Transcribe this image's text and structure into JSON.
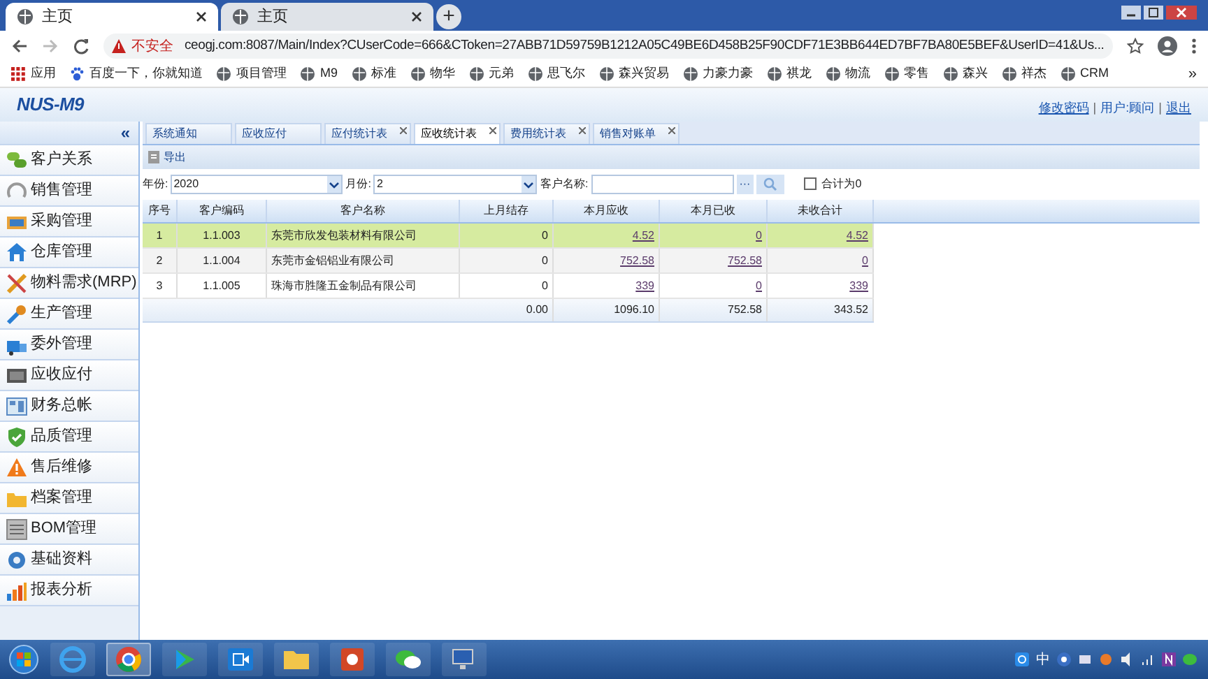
{
  "browser": {
    "tabs": [
      {
        "title": "主页",
        "selected": true
      },
      {
        "title": "主页",
        "selected": false
      }
    ],
    "new_tab": "+",
    "security": "不安全",
    "url": "ceogj.com:8087/Main/Index?CUserCode=666&CToken=27ABB71D59759B1212A05C49BE6D458B25F90CDF71E3BB644ED7BF7BA80E5BEF&UserID=41&Us...",
    "bookmarks": [
      "应用",
      "百度一下，你就知道",
      "项目管理",
      "M9",
      "标准",
      "物华",
      "元弟",
      "思飞尔",
      "森兴贸易",
      "力豪力豪",
      "祺龙",
      "物流",
      "零售",
      "森兴",
      "祥杰",
      "CRM"
    ],
    "bookmarks_more": "»"
  },
  "app": {
    "logo": "NUS-M9",
    "header_links": [
      {
        "kind": "link",
        "text": "修改密码"
      },
      {
        "kind": "sep",
        "text": "|"
      },
      {
        "kind": "text",
        "text": "用户:顾问"
      },
      {
        "kind": "sep",
        "text": "|"
      },
      {
        "kind": "link",
        "text": "退出"
      }
    ],
    "sidebar": {
      "collapse": "«",
      "items": [
        "客户关系",
        "销售管理",
        "采购管理",
        "仓库管理",
        "物料需求(MRP)",
        "生产管理",
        "委外管理",
        "应收应付",
        "财务总帐",
        "品质管理",
        "售后维修",
        "档案管理",
        "BOM管理",
        "基础资料",
        "报表分析"
      ]
    },
    "tabs": [
      {
        "label": "系统通知",
        "closable": false,
        "selected": false
      },
      {
        "label": "应收应付",
        "closable": false,
        "selected": false
      },
      {
        "label": "应付统计表",
        "closable": true,
        "selected": false
      },
      {
        "label": "应收统计表",
        "closable": true,
        "selected": true
      },
      {
        "label": "费用统计表",
        "closable": true,
        "selected": false
      },
      {
        "label": "销售对账单",
        "closable": true,
        "selected": false
      }
    ],
    "toolbar": {
      "export": "导出"
    },
    "filters": {
      "year_label": "年份:",
      "year": "2020",
      "month_label": "月份:",
      "month": "2",
      "customer_label": "客户名称:",
      "browse": "···",
      "zero_total": {
        "label": "合计为0",
        "checked": false
      }
    },
    "table": {
      "columns": [
        "序号",
        "客户编码",
        "客户名称",
        "上月结存",
        "本月应收",
        "本月已收",
        "未收合计"
      ],
      "rows": [
        {
          "selected": true,
          "cells": [
            "1",
            "1.1.003",
            "东莞市欣发包装材料有限公司",
            "0",
            "4.52",
            "0",
            "4.52"
          ]
        },
        {
          "selected": false,
          "cells": [
            "2",
            "1.1.004",
            "东莞市金铝铝业有限公司",
            "0",
            "752.58",
            "752.58",
            "0"
          ]
        },
        {
          "selected": false,
          "cells": [
            "3",
            "1.1.005",
            "珠海市胜隆五金制品有限公司",
            "0",
            "339",
            "0",
            "339"
          ]
        }
      ],
      "totals": [
        "0.00",
        "1096.10",
        "752.58",
        "343.52"
      ]
    }
  },
  "taskbar": {
    "tray_input": "中"
  }
}
